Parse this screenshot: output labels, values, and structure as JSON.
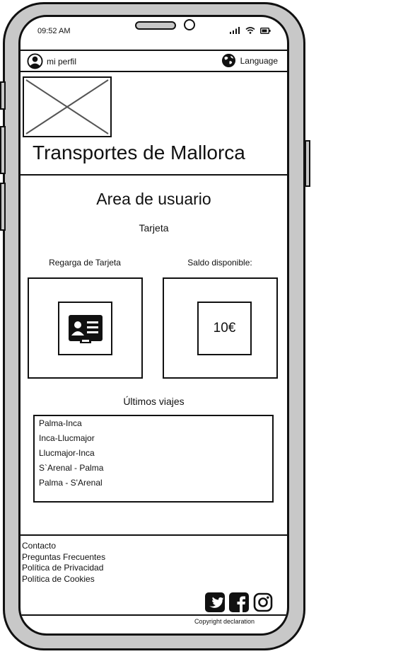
{
  "status": {
    "time": "09:52 AM"
  },
  "topbar": {
    "profile_label": "mi perfil",
    "language_label": "Language"
  },
  "header": {
    "title": "Transportes de Mallorca"
  },
  "main": {
    "title": "Area de usuario",
    "section": "Tarjeta",
    "recharge_label": "Regarga de Tarjeta",
    "balance_label": "Saldo disponible:",
    "balance_value": "10€",
    "recent_title": "Últimos viajes",
    "trips": [
      "Palma-Inca",
      "Inca-Llucmajor",
      "Llucmajor-Inca",
      "S`Arenal - Palma",
      "Palma - S'Arenal"
    ]
  },
  "footer": {
    "links": [
      "Contacto",
      "Preguntas Frecuentes",
      "Política de Privacidad",
      "Política de Cookies"
    ],
    "copyright": "Copyright declaration"
  },
  "icons": {
    "profile": "user-circle-icon",
    "language": "globe-icon",
    "card": "id-card-icon",
    "social": [
      "twitter-icon",
      "facebook-icon",
      "instagram-icon"
    ]
  }
}
